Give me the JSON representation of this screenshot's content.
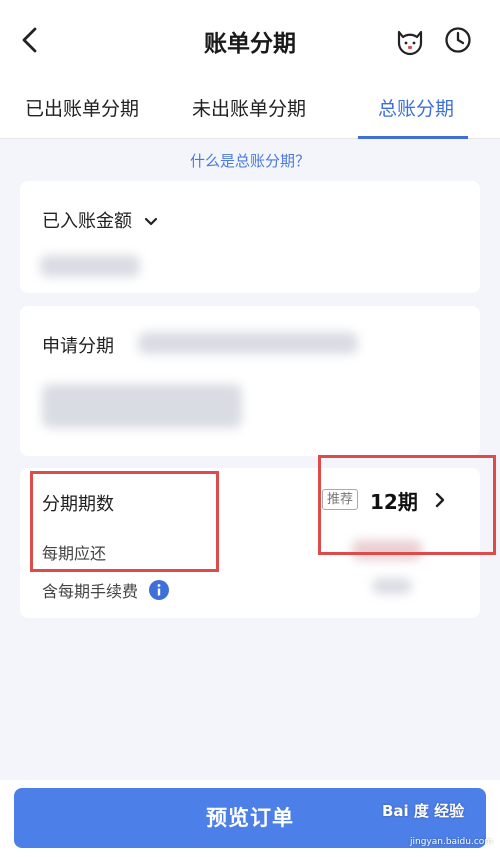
{
  "header": {
    "title": "账单分期",
    "back_icon": "chevron-left-icon",
    "cat_icon": "cat-face-icon",
    "clock_icon": "clock-icon"
  },
  "tabs": [
    {
      "label": "已出账单分期",
      "active": false
    },
    {
      "label": "未出账单分期",
      "active": false
    },
    {
      "label": "总账分期",
      "active": true
    }
  ],
  "help_link": "什么是总账分期？",
  "posted_card": {
    "label": "已入账金额"
  },
  "apply_card": {
    "label": "申请分期"
  },
  "installment_card": {
    "periods_label": "分期期数",
    "recommend_tag": "推荐",
    "periods_value": "12期",
    "per_period_label": "每期应还",
    "fee_label": "含每期手续费"
  },
  "primary_button": "预览订单",
  "watermark": {
    "brand": "Bai 度 经验",
    "url": "jingyan.baidu.com"
  },
  "colors": {
    "accent": "#3f6fd8",
    "button": "#4d7fe8",
    "highlight_box": "#dd4b4b",
    "info_icon": "#3f6fd8"
  }
}
